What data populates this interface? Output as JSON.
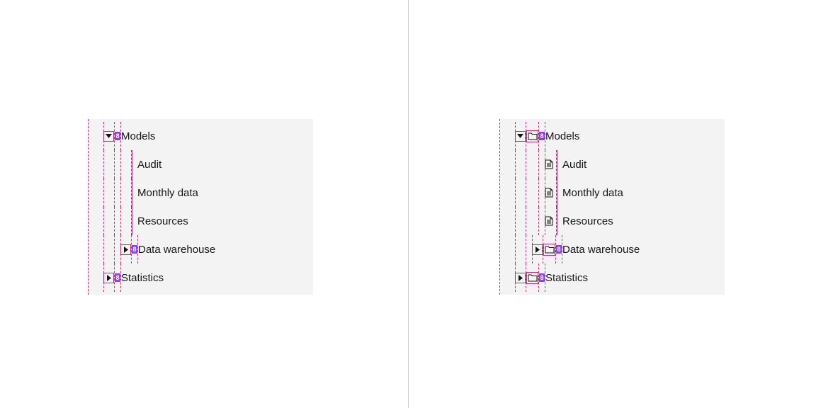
{
  "spacing_token": "8",
  "left_tree": {
    "items": [
      {
        "label": "Models",
        "expanded": true
      },
      {
        "label": "Audit"
      },
      {
        "label": "Monthly data"
      },
      {
        "label": "Resources"
      },
      {
        "label": "Data warehouse",
        "expanded": false
      },
      {
        "label": "Statistics",
        "expanded": false
      }
    ]
  },
  "right_tree": {
    "items": [
      {
        "label": "Models",
        "icon": "folder",
        "expanded": true
      },
      {
        "label": "Audit",
        "icon": "document"
      },
      {
        "label": "Monthly data",
        "icon": "document"
      },
      {
        "label": "Resources",
        "icon": "document"
      },
      {
        "label": "Data warehouse",
        "icon": "folder",
        "expanded": false
      },
      {
        "label": "Statistics",
        "icon": "folder",
        "expanded": false
      }
    ]
  },
  "colors": {
    "spec_pink": "#d12771",
    "spec_purple": "#8a3ffc",
    "panel_bg": "#f3f3f3",
    "text": "#161616"
  }
}
